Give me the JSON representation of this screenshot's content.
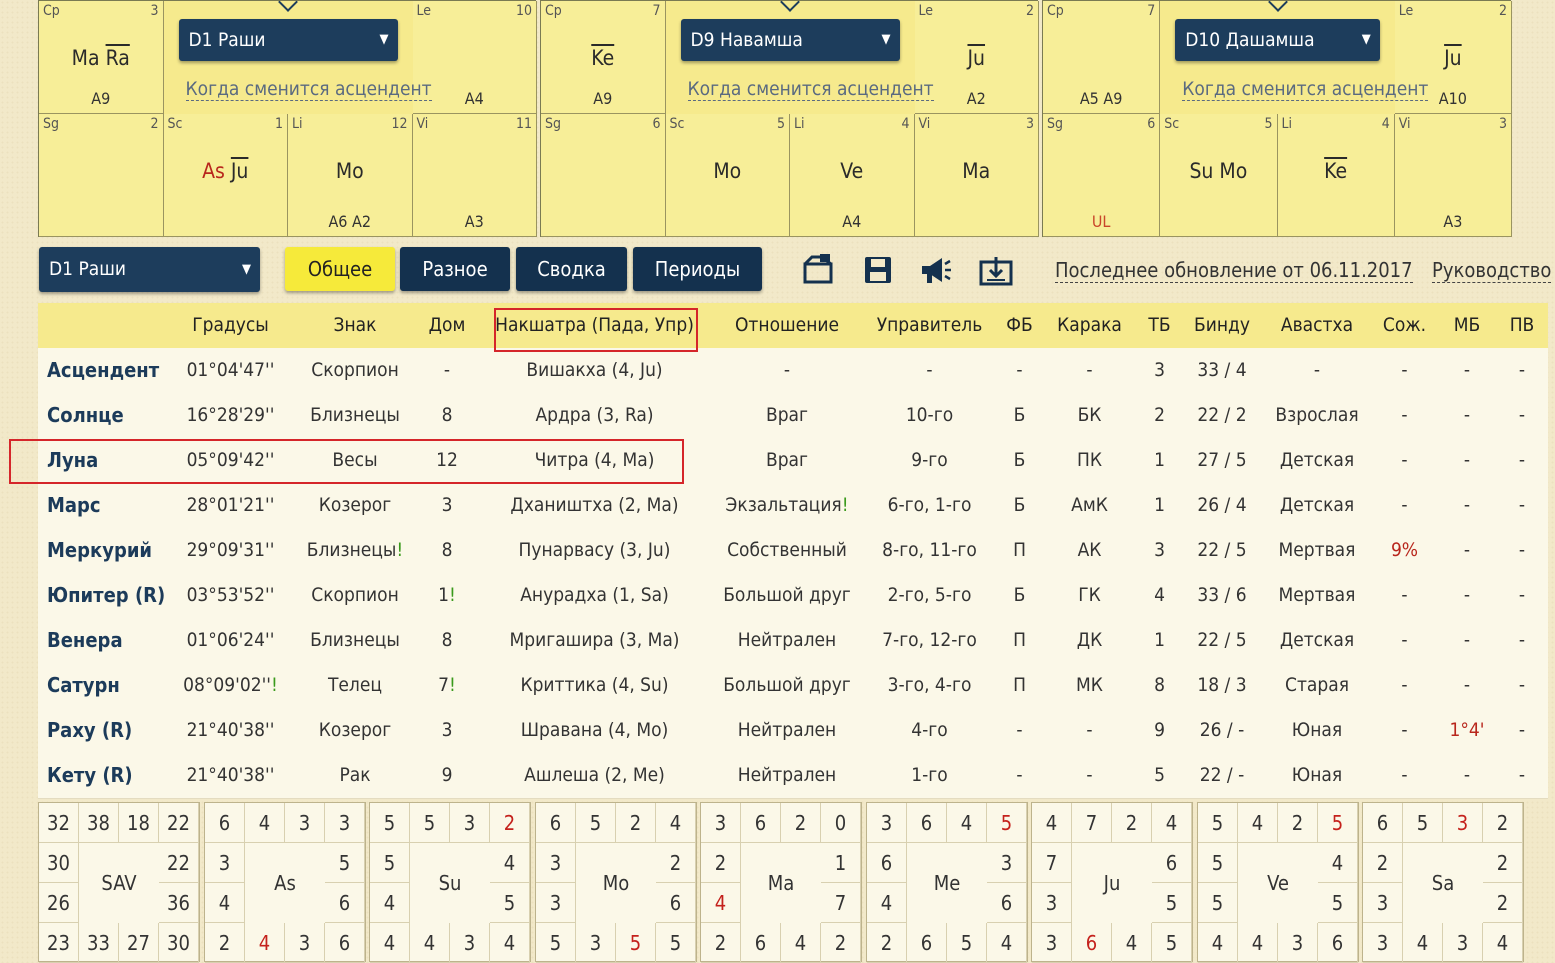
{
  "charts": [
    {
      "dropdown": "D1 Раши",
      "link": "Когда сменится асцендент",
      "cells": [
        {
          "sign": "Cp",
          "num": "3",
          "planets": [
            {
              "t": "Ma",
              "red": false,
              "ov": false
            },
            {
              "t": "Ra",
              "red": false,
              "ov": true
            }
          ],
          "arudha": "A9"
        },
        {
          "sign": "Le",
          "num": "10",
          "planets": [],
          "arudha": "A4"
        },
        {
          "sign": "Sg",
          "num": "2",
          "planets": [],
          "arudha": ""
        },
        {
          "sign": "Sc",
          "num": "1",
          "planets": [
            {
              "t": "As",
              "red": true,
              "ov": false
            },
            {
              "t": "Ju",
              "red": false,
              "ov": true
            }
          ],
          "arudha": ""
        },
        {
          "sign": "Li",
          "num": "12",
          "planets": [
            {
              "t": "Mo",
              "red": false,
              "ov": false
            }
          ],
          "arudha": "A6 A2"
        },
        {
          "sign": "Vi",
          "num": "11",
          "planets": [],
          "arudha": "A3"
        }
      ]
    },
    {
      "dropdown": "D9 Навамша",
      "link": "Когда сменится асцендент",
      "cells": [
        {
          "sign": "Cp",
          "num": "7",
          "planets": [
            {
              "t": "Ke",
              "red": false,
              "ov": true
            }
          ],
          "arudha": "A9"
        },
        {
          "sign": "Le",
          "num": "2",
          "planets": [
            {
              "t": "Ju",
              "red": false,
              "ov": true
            }
          ],
          "arudha": "A2"
        },
        {
          "sign": "Sg",
          "num": "6",
          "planets": [],
          "arudha": ""
        },
        {
          "sign": "Sc",
          "num": "5",
          "planets": [
            {
              "t": "Mo",
              "red": false,
              "ov": false
            }
          ],
          "arudha": ""
        },
        {
          "sign": "Li",
          "num": "4",
          "planets": [
            {
              "t": "Ve",
              "red": false,
              "ov": false
            }
          ],
          "arudha": "A4"
        },
        {
          "sign": "Vi",
          "num": "3",
          "planets": [
            {
              "t": "Ma",
              "red": false,
              "ov": false
            }
          ],
          "arudha": ""
        }
      ]
    },
    {
      "dropdown": "D10 Дашамша",
      "link": "Когда сменится асцендент",
      "cells": [
        {
          "sign": "Cp",
          "num": "7",
          "planets": [],
          "arudha": "A5 A9"
        },
        {
          "sign": "Le",
          "num": "2",
          "planets": [
            {
              "t": "Ju",
              "red": false,
              "ov": true
            }
          ],
          "arudha": "A10"
        },
        {
          "sign": "Sg",
          "num": "6",
          "planets": [],
          "arudha": "UL"
        },
        {
          "sign": "Sc",
          "num": "5",
          "planets": [
            {
              "t": "Su",
              "red": false,
              "ov": false
            },
            {
              "t": "Mo",
              "red": false,
              "ov": false
            }
          ],
          "arudha": ""
        },
        {
          "sign": "Li",
          "num": "4",
          "planets": [
            {
              "t": "Ke",
              "red": false,
              "ov": true
            }
          ],
          "arudha": ""
        },
        {
          "sign": "Vi",
          "num": "3",
          "planets": [],
          "arudha": "A3"
        }
      ]
    }
  ],
  "toolbar": {
    "chart_select": "D1 Раши",
    "tabs": [
      "Общее",
      "Разное",
      "Сводка",
      "Периоды"
    ],
    "active_tab": 0,
    "icons": [
      "export-chart-icon",
      "save-icon",
      "announce-icon",
      "download-icon"
    ],
    "update_text": "Последнее обновление от 06.11.2017",
    "guide_link": "Руководство"
  },
  "table": {
    "headers": [
      "",
      "Градусы",
      "Знак",
      "Дом",
      "Накшатра (Пада, Упр)",
      "Отношение",
      "Управитель",
      "ФБ",
      "Карака",
      "ТБ",
      "Бинду",
      "Авастха",
      "Сож.",
      "МБ",
      "ПВ"
    ],
    "rows": [
      {
        "name": "Асцендент",
        "deg": "01°04'47''",
        "sign": "Скорпион",
        "house": "-",
        "nak": "Вишакха (4, Ju)",
        "rel": "-",
        "lord": "-",
        "fb": "-",
        "kar": "-",
        "tb": "3",
        "bindu": "33 / 4",
        "av": "-",
        "soz": "-",
        "mb": "-",
        "pv": "-"
      },
      {
        "name": "Солнце",
        "deg": "16°28'29''",
        "sign": "Близнецы",
        "house": "8",
        "nak": "Ардра (3, Ra)",
        "rel": "Враг",
        "lord": "10-го",
        "fb": "Б",
        "kar": "БК",
        "tb": "2",
        "bindu": "22 / 2",
        "av": "Взрослая",
        "soz": "-",
        "mb": "-",
        "pv": "-"
      },
      {
        "name": "Луна",
        "deg": "05°09'42''",
        "sign": "Весы",
        "house": "12",
        "nak": "Читра (4, Ma)",
        "rel": "Враг",
        "lord": "9-го",
        "fb": "Б",
        "kar": "ПК",
        "tb": "1",
        "bindu": "27 / 5",
        "av": "Детская",
        "soz": "-",
        "mb": "-",
        "pv": "-"
      },
      {
        "name": "Марс",
        "deg": "28°01'21''",
        "sign": "Козерог",
        "house": "3",
        "nak": "Дхаништха (2, Ma)",
        "rel": "Экзальтация",
        "rel_mark": "!",
        "lord": "6-го, 1-го",
        "fb": "Б",
        "kar": "АмК",
        "tb": "1",
        "bindu": "26 / 4",
        "av": "Детская",
        "soz": "-",
        "mb": "-",
        "pv": "-"
      },
      {
        "name": "Меркурий",
        "deg": "29°09'31''",
        "sign": "Близнецы",
        "sign_mark": "!",
        "house": "8",
        "nak": "Пунарвасу (3, Ju)",
        "rel": "Собственный",
        "lord": "8-го, 11-го",
        "fb": "П",
        "kar": "АК",
        "tb": "3",
        "bindu": "22 / 5",
        "av": "Мертвая",
        "soz": "9%",
        "soz_red": true,
        "mb": "-",
        "pv": "-"
      },
      {
        "name": "Юпитер (R)",
        "deg": "03°53'52''",
        "sign": "Скорпион",
        "house": "1",
        "house_mark": "!",
        "nak": "Анурадха (1, Sa)",
        "rel": "Большой друг",
        "lord": "2-го, 5-го",
        "fb": "Б",
        "kar": "ГК",
        "tb": "4",
        "bindu": "33 / 6",
        "av": "Мертвая",
        "soz": "-",
        "mb": "-",
        "pv": "-"
      },
      {
        "name": "Венера",
        "deg": "01°06'24''",
        "sign": "Близнецы",
        "house": "8",
        "nak": "Мригашира (3, Ma)",
        "rel": "Нейтрален",
        "lord": "7-го, 12-го",
        "fb": "П",
        "kar": "ДК",
        "tb": "1",
        "bindu": "22 / 5",
        "av": "Детская",
        "soz": "-",
        "mb": "-",
        "pv": "-"
      },
      {
        "name": "Сатурн",
        "deg": "08°09'02''",
        "deg_mark": "!",
        "sign": "Телец",
        "house": "7",
        "house_mark": "!",
        "nak": "Криттика (4, Su)",
        "rel": "Большой друг",
        "lord": "3-го, 4-го",
        "fb": "П",
        "kar": "МК",
        "tb": "8",
        "bindu": "18 / 3",
        "av": "Старая",
        "soz": "-",
        "mb": "-",
        "pv": "-"
      },
      {
        "name": "Раху (R)",
        "deg": "21°40'38''",
        "sign": "Козерог",
        "house": "3",
        "nak": "Шравана (4, Mo)",
        "rel": "Нейтрален",
        "lord": "4-го",
        "fb": "-",
        "kar": "-",
        "tb": "9",
        "bindu": "26 / -",
        "av": "Юная",
        "soz": "-",
        "mb": "1°4'",
        "mb_red": true,
        "pv": "-"
      },
      {
        "name": "Кету (R)",
        "deg": "21°40'38''",
        "sign": "Рак",
        "house": "9",
        "nak": "Ашлеша (2, Me)",
        "rel": "Нейтрален",
        "lord": "1-го",
        "fb": "-",
        "kar": "-",
        "tb": "5",
        "bindu": "22 / -",
        "av": "Юная",
        "soz": "-",
        "mb": "-",
        "pv": "-"
      }
    ]
  },
  "ashtakavarga": [
    {
      "label": "SAV",
      "top": [
        "32",
        "38",
        "18",
        "22"
      ],
      "left": [
        "30",
        "26"
      ],
      "right": [
        "22",
        "36"
      ],
      "bottom": [
        "23",
        "33",
        "27",
        "30"
      ],
      "red": []
    },
    {
      "label": "As",
      "top": [
        "6",
        "4",
        "3",
        "3"
      ],
      "left": [
        "3",
        "4"
      ],
      "right": [
        "5",
        "6"
      ],
      "bottom": [
        "2",
        "4",
        "3",
        "6"
      ],
      "red": [
        "b1"
      ]
    },
    {
      "label": "Su",
      "top": [
        "5",
        "5",
        "3",
        "2"
      ],
      "left": [
        "5",
        "4"
      ],
      "right": [
        "4",
        "5"
      ],
      "bottom": [
        "4",
        "4",
        "3",
        "4"
      ],
      "red": [
        "t3"
      ]
    },
    {
      "label": "Mo",
      "top": [
        "6",
        "5",
        "2",
        "4"
      ],
      "left": [
        "3",
        "3"
      ],
      "right": [
        "2",
        "6"
      ],
      "bottom": [
        "5",
        "3",
        "5",
        "5"
      ],
      "red": [
        "b2"
      ]
    },
    {
      "label": "Ma",
      "top": [
        "3",
        "6",
        "2",
        "0"
      ],
      "left": [
        "2",
        "4"
      ],
      "right": [
        "1",
        "7"
      ],
      "bottom": [
        "2",
        "6",
        "4",
        "2"
      ],
      "red": [
        "l1"
      ]
    },
    {
      "label": "Me",
      "top": [
        "3",
        "6",
        "4",
        "5"
      ],
      "left": [
        "6",
        "4"
      ],
      "right": [
        "3",
        "6"
      ],
      "bottom": [
        "2",
        "6",
        "5",
        "4"
      ],
      "red": [
        "t3"
      ]
    },
    {
      "label": "Ju",
      "top": [
        "4",
        "7",
        "2",
        "4"
      ],
      "left": [
        "7",
        "3"
      ],
      "right": [
        "6",
        "5"
      ],
      "bottom": [
        "3",
        "6",
        "4",
        "5"
      ],
      "red": [
        "b1"
      ]
    },
    {
      "label": "Ve",
      "top": [
        "5",
        "4",
        "2",
        "5"
      ],
      "left": [
        "5",
        "5"
      ],
      "right": [
        "4",
        "5"
      ],
      "bottom": [
        "4",
        "4",
        "3",
        "6"
      ],
      "red": [
        "t3"
      ]
    },
    {
      "label": "Sa",
      "top": [
        "6",
        "5",
        "3",
        "2"
      ],
      "left": [
        "2",
        "3"
      ],
      "right": [
        "2",
        "2"
      ],
      "bottom": [
        "3",
        "4",
        "3",
        "4"
      ],
      "red": [
        "t2"
      ]
    }
  ]
}
